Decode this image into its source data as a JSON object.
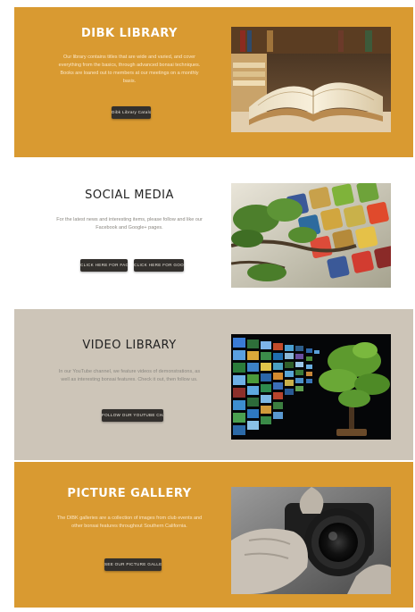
{
  "sections": [
    {
      "title": "DIBK LIBRARY",
      "description": "Our library contains titles that are wide and varied, and cover everything from the basics, through advanced bonsai techniques. Books are loaned out to members at our meetings on a monthly basis.",
      "buttons": [
        "Dibk Library Catalog"
      ],
      "image_icon": "open-books-photo"
    },
    {
      "title": "SOCIAL MEDIA",
      "description": "For the latest news and interesting items, please follow and like our Facebook and Google+ pages.",
      "buttons": [
        "CLICK HERE FOR FACEBOOK",
        "CLICK HERE FOR GOOGLE +"
      ],
      "image_icon": "social-media-bonsai-photo"
    },
    {
      "title": "VIDEO LIBRARY",
      "description": "In our YouTube channel, we feature videos of demonstrations, as well as interesting bonsai features. Check it out, then follow us.",
      "buttons": [
        "FOLLOW OUR YOUTUBE CHANNEL"
      ],
      "image_icon": "video-wall-bonsai-photo"
    },
    {
      "title": "PICTURE GALLERY",
      "description": "The DIBK galleries are a collection of images from club events and other bonsai features throughout Southern California.",
      "buttons": [
        "SEE OUR PICTURE GALLERY"
      ],
      "image_icon": "camera-hands-photo"
    }
  ],
  "colors": {
    "accent_orange": "#d99a31",
    "taupe": "#cdc5b8",
    "button_dark": "#33302d"
  }
}
